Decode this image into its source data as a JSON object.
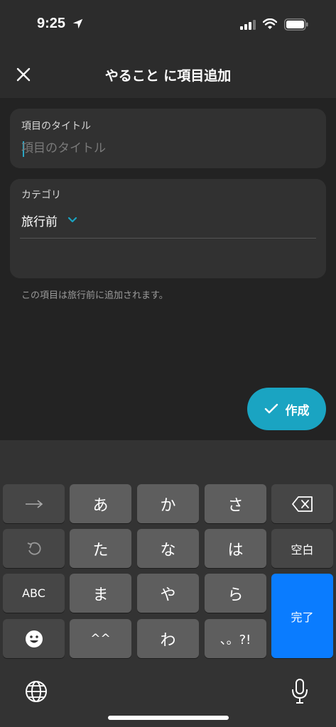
{
  "status_bar": {
    "time": "9:25"
  },
  "header": {
    "title": "やること に項目追加"
  },
  "title_field": {
    "label": "項目のタイトル",
    "placeholder": "項目のタイトル",
    "value": ""
  },
  "category_field": {
    "label": "カテゴリ",
    "selected": "旅行前"
  },
  "helper_text": "この項目は旅行前に追加されます。",
  "create_button": {
    "label": "作成"
  },
  "colors": {
    "accent": "#1aa4c2",
    "done_key": "#0a7cff"
  },
  "keyboard": {
    "keys": {
      "a": "あ",
      "ka": "か",
      "sa": "さ",
      "ta": "た",
      "na": "な",
      "ha": "は",
      "space": "空白",
      "abc": "ABC",
      "ma": "ま",
      "ya": "や",
      "ra": "ら",
      "done": "完了",
      "kaomoji": "^^",
      "wa": "わ",
      "punct": "、。?!"
    }
  }
}
